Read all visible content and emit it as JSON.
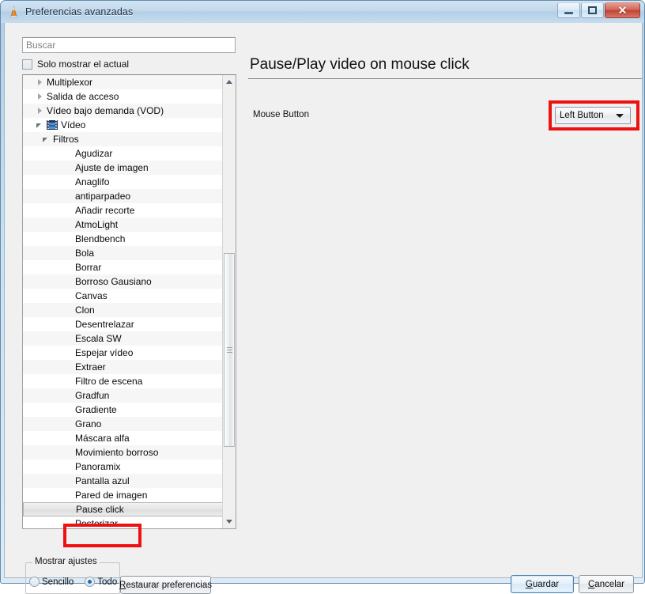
{
  "window": {
    "title": "Preferencias avanzadas",
    "icon": "vlc-cone-icon",
    "controls": {
      "minimize": "minimize-button",
      "maximize": "maximize-button",
      "close_glyph": "✕"
    }
  },
  "sidebar": {
    "search": {
      "placeholder": "Buscar",
      "value": ""
    },
    "only_current_checkbox": {
      "label": "Solo mostrar el actual",
      "checked": false
    },
    "tree": [
      {
        "label": "Multiplexor",
        "level": 0,
        "state": "collapsed",
        "icon": "",
        "selected": false
      },
      {
        "label": "Salida de acceso",
        "level": 0,
        "state": "collapsed",
        "icon": "",
        "selected": false
      },
      {
        "label": "Vídeo bajo demanda (VOD)",
        "level": 0,
        "state": "collapsed",
        "icon": "",
        "selected": false
      },
      {
        "label": "Vídeo",
        "level": 0,
        "state": "expanded",
        "icon": "filmstrip-icon",
        "selected": false
      },
      {
        "label": "Filtros",
        "level": 1,
        "state": "expanded",
        "icon": "",
        "selected": false
      },
      {
        "label": "Agudizar",
        "level": 2,
        "state": "leaf",
        "icon": "",
        "selected": false
      },
      {
        "label": "Ajuste de imagen",
        "level": 2,
        "state": "leaf",
        "icon": "",
        "selected": false
      },
      {
        "label": "Anaglifo",
        "level": 2,
        "state": "leaf",
        "icon": "",
        "selected": false
      },
      {
        "label": "antiparpadeo",
        "level": 2,
        "state": "leaf",
        "icon": "",
        "selected": false
      },
      {
        "label": "Añadir recorte",
        "level": 2,
        "state": "leaf",
        "icon": "",
        "selected": false
      },
      {
        "label": "AtmoLight",
        "level": 2,
        "state": "leaf",
        "icon": "",
        "selected": false
      },
      {
        "label": "Blendbench",
        "level": 2,
        "state": "leaf",
        "icon": "",
        "selected": false
      },
      {
        "label": "Bola",
        "level": 2,
        "state": "leaf",
        "icon": "",
        "selected": false
      },
      {
        "label": "Borrar",
        "level": 2,
        "state": "leaf",
        "icon": "",
        "selected": false
      },
      {
        "label": "Borroso Gausiano",
        "level": 2,
        "state": "leaf",
        "icon": "",
        "selected": false
      },
      {
        "label": "Canvas",
        "level": 2,
        "state": "leaf",
        "icon": "",
        "selected": false
      },
      {
        "label": "Clon",
        "level": 2,
        "state": "leaf",
        "icon": "",
        "selected": false
      },
      {
        "label": "Desentrelazar",
        "level": 2,
        "state": "leaf",
        "icon": "",
        "selected": false
      },
      {
        "label": "Escala SW",
        "level": 2,
        "state": "leaf",
        "icon": "",
        "selected": false
      },
      {
        "label": "Espejar vídeo",
        "level": 2,
        "state": "leaf",
        "icon": "",
        "selected": false
      },
      {
        "label": "Extraer",
        "level": 2,
        "state": "leaf",
        "icon": "",
        "selected": false
      },
      {
        "label": "Filtro de escena",
        "level": 2,
        "state": "leaf",
        "icon": "",
        "selected": false
      },
      {
        "label": "Gradfun",
        "level": 2,
        "state": "leaf",
        "icon": "",
        "selected": false
      },
      {
        "label": "Gradiente",
        "level": 2,
        "state": "leaf",
        "icon": "",
        "selected": false
      },
      {
        "label": "Grano",
        "level": 2,
        "state": "leaf",
        "icon": "",
        "selected": false
      },
      {
        "label": "Máscara alfa",
        "level": 2,
        "state": "leaf",
        "icon": "",
        "selected": false
      },
      {
        "label": "Movimiento borroso",
        "level": 2,
        "state": "leaf",
        "icon": "",
        "selected": false
      },
      {
        "label": "Panoramix",
        "level": 2,
        "state": "leaf",
        "icon": "",
        "selected": false
      },
      {
        "label": "Pantalla azul",
        "level": 2,
        "state": "leaf",
        "icon": "",
        "selected": false
      },
      {
        "label": "Pared de imagen",
        "level": 2,
        "state": "leaf",
        "icon": "",
        "selected": false
      },
      {
        "label": "Pause click",
        "level": 2,
        "state": "leaf",
        "icon": "",
        "selected": true
      },
      {
        "label": "Posterizar",
        "level": 2,
        "state": "leaf",
        "icon": "",
        "selected": false
      }
    ],
    "scrollbar": {
      "up_arrow": "scroll-up-arrow",
      "down_arrow": "scroll-down-arrow"
    }
  },
  "main": {
    "title": "Pause/Play video on mouse click",
    "fields": [
      {
        "label": "Mouse Button",
        "control": "dropdown",
        "value": "Left Button"
      }
    ]
  },
  "annotations": {
    "color": "#ee1111",
    "boxes": [
      "mouse-button-dropdown",
      "tree-item-pause-click"
    ]
  },
  "footer": {
    "group_legend": "Mostrar ajustes",
    "radios": [
      {
        "label": "Sencillo",
        "checked": false
      },
      {
        "label": "Todo",
        "checked": true
      }
    ],
    "restore_button": "Restaurar preferencias",
    "save_button": "Guardar",
    "cancel_button": "Cancelar"
  }
}
